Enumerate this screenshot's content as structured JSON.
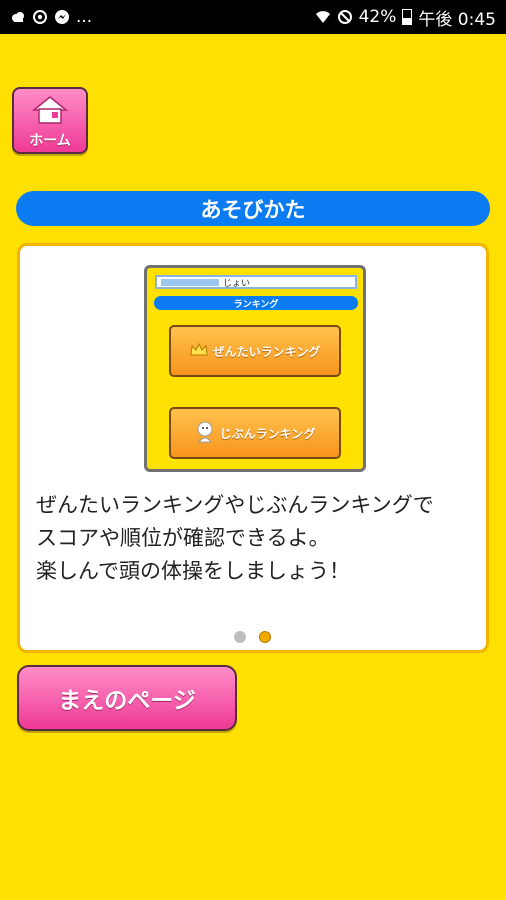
{
  "status_bar": {
    "time": "午後 0:45",
    "battery": "42%",
    "more": "...",
    "left_icons": [
      "cloud-icon",
      "at-sign-icon",
      "facebook-messenger-icon"
    ],
    "right_icons": [
      "wifi-icon",
      "do-not-disturb-icon",
      "battery-icon"
    ]
  },
  "home_button": {
    "label": "ホーム",
    "icon": "house-icon",
    "color": "#EE3A95"
  },
  "section": {
    "title": "あそびかた",
    "color": "#0A7BF0"
  },
  "preview": {
    "search_value": "じょい",
    "title": "ランキング",
    "buttons": [
      {
        "label": "ぜんたいランキング",
        "icon": "crown-icon"
      },
      {
        "label": "じぶんランキング",
        "icon": "person-icon"
      }
    ]
  },
  "description": {
    "lines": [
      "ぜんたいランキングやじぶんランキングで",
      "スコアや順位が確認できるよ。",
      "楽しんで頭の体操をしましょう！"
    ]
  },
  "pagination": {
    "count": 2,
    "current": 2
  },
  "prev_button": {
    "label": "まえのページ",
    "color": "#EE3A95"
  },
  "colors": {
    "background": "#FFE000",
    "card_border": "#F2B400"
  }
}
